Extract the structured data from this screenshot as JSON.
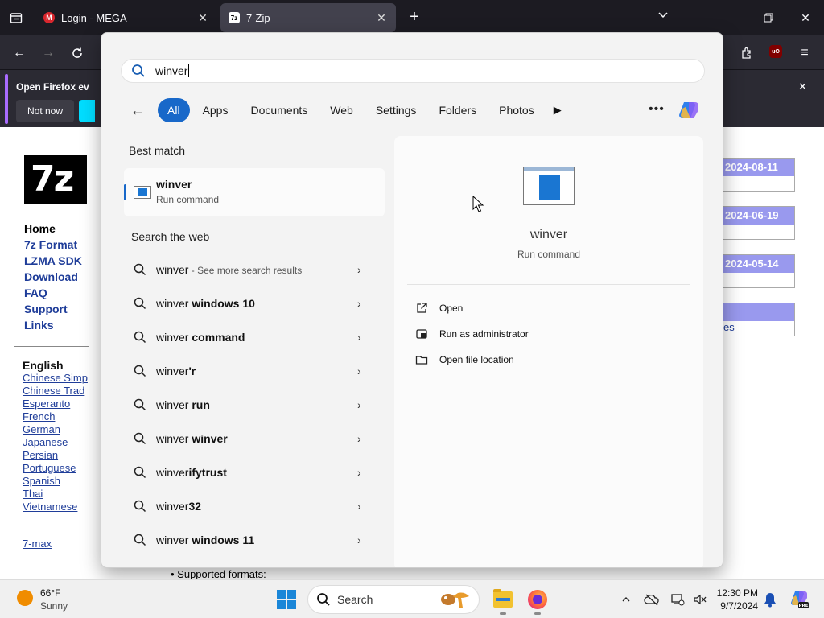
{
  "browser": {
    "tabs": [
      {
        "title": "Login - MEGA",
        "favicon": "mega-icon",
        "active": false
      },
      {
        "title": "7-Zip",
        "favicon": "7zip-icon",
        "active": true
      }
    ],
    "notification": {
      "title": "Open Firefox ev",
      "dismiss_label": "Not now"
    }
  },
  "page": {
    "logo_text": "7z",
    "menu": [
      "Home",
      "7z Format",
      "LZMA SDK",
      "Download",
      "FAQ",
      "Support",
      "Links"
    ],
    "language_heading": "English",
    "languages": [
      "Chinese Simp",
      "Chinese Trad",
      "Esperanto",
      "French",
      "German",
      "Japanese",
      "Persian",
      "Portuguese",
      "Spanish",
      "Thai",
      "Vietnamese"
    ],
    "seven_max": "7-max",
    "news_dates": [
      "2024-08-11",
      "2024-06-19",
      "2024-05-14"
    ],
    "partial_link": "es",
    "supported_formats": "• Supported formats:"
  },
  "search": {
    "query": "winver",
    "filters": [
      "All",
      "Apps",
      "Documents",
      "Web",
      "Settings",
      "Folders",
      "Photos"
    ],
    "active_filter": "All",
    "best_match_heading": "Best match",
    "best_match": {
      "name": "winver",
      "type": "Run command"
    },
    "web_heading": "Search the web",
    "web_results": [
      {
        "prefix": "winver",
        "suffix": "",
        "note": " - See more search results"
      },
      {
        "prefix": "winver",
        "suffix": " windows 10",
        "note": ""
      },
      {
        "prefix": "winver",
        "suffix": " command",
        "note": ""
      },
      {
        "prefix": "winver",
        "suffix": "'r",
        "note": ""
      },
      {
        "prefix": "winver",
        "suffix": " run",
        "note": ""
      },
      {
        "prefix": "winver",
        "suffix": " winver",
        "note": ""
      },
      {
        "prefix": "winver",
        "suffix": "ifytrust",
        "note": ""
      },
      {
        "prefix": "winver",
        "suffix": "32",
        "note": ""
      },
      {
        "prefix": "winver",
        "suffix": " windows 11",
        "note": ""
      }
    ],
    "detail": {
      "name": "winver",
      "type": "Run command",
      "actions": [
        "Open",
        "Run as administrator",
        "Open file location"
      ]
    }
  },
  "taskbar": {
    "weather_temp": "66°F",
    "weather_desc": "Sunny",
    "search_label": "Search",
    "time": "12:30 PM",
    "date": "9/7/2024"
  },
  "colors": {
    "accent": "#1868c9",
    "zip_link": "#1f3d99",
    "news_header": "#9999ee"
  }
}
